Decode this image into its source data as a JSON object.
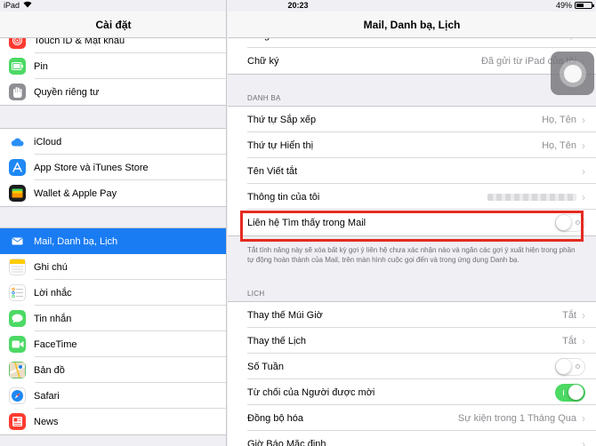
{
  "status_bar": {
    "device": "iPad",
    "time": "20:23",
    "battery": "49%",
    "battery_level": 0.49
  },
  "left": {
    "title": "Cài đặt",
    "groups": [
      [
        {
          "label": "Touch ID & Mật khẩu",
          "icon": "fingerprint-icon",
          "color": "#ff3b30"
        },
        {
          "label": "Pin",
          "icon": "battery-icon",
          "color": "#4cd964"
        },
        {
          "label": "Quyền riêng tư",
          "icon": "hand-icon",
          "color": "#8e8e93"
        }
      ],
      [
        {
          "label": "iCloud",
          "icon": "cloud-icon",
          "color": "#ffffff"
        },
        {
          "label": "App Store và iTunes Store",
          "icon": "app-store-icon",
          "color": "#1e88f5"
        },
        {
          "label": "Wallet & Apple Pay",
          "icon": "wallet-icon",
          "color": "#1c1c1e"
        }
      ],
      [
        {
          "label": "Mail, Danh bạ, Lịch",
          "icon": "mail-icon",
          "color": "#1a7cf2",
          "selected": true
        },
        {
          "label": "Ghi chú",
          "icon": "notes-icon",
          "color": "#ffcc00"
        },
        {
          "label": "Lời nhắc",
          "icon": "reminders-icon",
          "color": "#ffffff"
        },
        {
          "label": "Tin nhắn",
          "icon": "messages-icon",
          "color": "#4cd964"
        },
        {
          "label": "FaceTime",
          "icon": "facetime-icon",
          "color": "#4cd964"
        },
        {
          "label": "Bản đồ",
          "icon": "maps-icon",
          "color": "#62c16a"
        },
        {
          "label": "Safari",
          "icon": "safari-icon",
          "color": "#1e88f5"
        },
        {
          "label": "News",
          "icon": "news-icon",
          "color": "#ff3b30"
        }
      ]
    ]
  },
  "right": {
    "title": "Mail, Danh bạ, Lịch",
    "top_partial_label": "Tăng Mức Trích dẫn",
    "top_partial_value": "Bật",
    "signature": {
      "label": "Chữ ký",
      "value": "Đã gửi từ iPad của tôi"
    },
    "contacts_section": "DANH BẠ",
    "contacts_rows": [
      {
        "label": "Thứ tự Sắp xếp",
        "value": "Họ, Tên"
      },
      {
        "label": "Thứ tự Hiển thị",
        "value": "Họ, Tên"
      },
      {
        "label": "Tên Viết tắt",
        "value": ""
      },
      {
        "label": "Thông tin của tôi",
        "value": ""
      }
    ],
    "found_in_mail": {
      "label": "Liên hệ Tìm thấy trong Mail",
      "on": false
    },
    "found_in_mail_note": "Tắt tính năng này sẽ xóa bất kỳ gợi ý liên hệ chưa xác nhận nào và ngăn các gợi ý xuất hiện trong phần tự động hoàn thành của Mail, trên màn hình cuộc gọi đến và trong ứng dụng Danh bạ.",
    "calendar_section": "LỊCH",
    "calendar_rows": [
      {
        "label": "Thay thế Múi Giờ",
        "value": "Tắt",
        "kind": "value"
      },
      {
        "label": "Thay thế Lịch",
        "value": "Tắt",
        "kind": "value"
      },
      {
        "label": "Số Tuần",
        "kind": "toggle",
        "on": false
      },
      {
        "label": "Từ chối của Người được mời",
        "kind": "toggle",
        "on": true
      },
      {
        "label": "Đồng bộ hóa",
        "value": "Sự kiện trong 1 Tháng Qua",
        "kind": "value"
      },
      {
        "label": "Giờ Báo Mặc định",
        "value": "",
        "kind": "value"
      }
    ]
  }
}
